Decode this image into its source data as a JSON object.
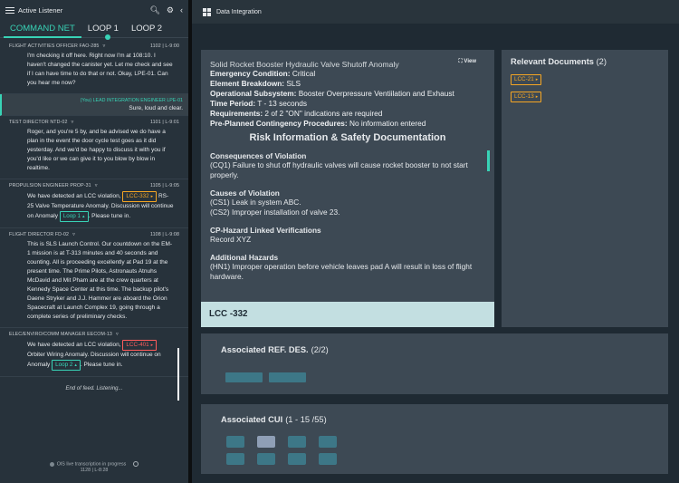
{
  "left_panel": {
    "title": "Active Listener",
    "tabs": [
      {
        "label": "COMMAND NET",
        "active": true
      },
      {
        "label": "LOOP 1",
        "active": false
      },
      {
        "label": "LOOP 2",
        "active": false
      }
    ],
    "messages": [
      {
        "speaker": "FLIGHT ACTIVITIES OFFICER FAO-285",
        "time": "1102 | L-9:00",
        "text": "I'm checking it off here. Right now I'm at 108:10. I haven't changed the canister yet. Let me check and see if I can have time to do that or not. Okay, LPE-01. Can you hear me now?"
      },
      {
        "speaker": "TEST DIRECTOR NTD-02",
        "time": "1101 | L-9:01",
        "text": "Roger, and you're 5 by, and be advised we do have a plan in the event the door cycle test goes as it did yesterday. And we'd be happy to discuss it with you if you'd like or we can give it to you blow by blow in realtime."
      },
      {
        "speaker": "PROPULSION ENGINEER PROP-31",
        "time": "1105 | L-9:05",
        "text_a": "We have detected an LCC violation,",
        "chip": "LCC-332",
        "text_b": "RS-25 Valve Temperature Anomaly. Discussion will continue on Anomaly",
        "loop_chip": "Loop 1",
        "text_c": ". Please tune in."
      },
      {
        "speaker": "FLIGHT DIRECTOR FD-02",
        "time": "1108 | L-9:08",
        "text": "This is SLS Launch Control. Our countdown on the EM-1 mission is at T-313 minutes and 40 seconds and counting. All is proceeding excellently at Pad 19 at the present time. The Prime Pilots, Astronauts Atnuhs McDavid and Mit Pham are at the crew quarters at Kennedy Space Center at this time. The backup pilot's Daene Stryker and J.J. Hammer are aboard the Orion Spacecraft at Launch Complex 19, going through a complete series of preliminary checks."
      },
      {
        "speaker": "ELEC/ENVIRO/COMM MANAGER EECOM-13",
        "time": "",
        "text_a": "We have detected an LCC violation,",
        "chip": "LCC-401",
        "text_b": "Orbiter Wiring Anomaly. Discussion will continue on Anomaly",
        "loop_chip": "Loop 2",
        "text_c": ". Please tune in."
      }
    ],
    "lead_reply": {
      "label": "(You) LEAD INTEGRATION ENGINEER  LPE-01",
      "text": "Sure, loud and clear."
    },
    "end_text": "End of feed. Listening...",
    "footer_status": "OIS live transcription in progress",
    "footer_time": "1128 | L-8:28"
  },
  "topbar": {
    "title": "Data Integration"
  },
  "anomaly": {
    "view_label": "View",
    "title": "Solid Rocket Booster Hydraulic Valve Shutoff Anomaly",
    "fields": [
      {
        "k": "Emergency Condition:",
        "v": "Critical"
      },
      {
        "k": "Element Breakdown:",
        "v": "SLS"
      },
      {
        "k": "Operational Subsystem:",
        "v": "Booster Overpressure Ventiilation and Exhaust"
      },
      {
        "k": "Time Period:",
        "v": "T - 13 seconds"
      },
      {
        "k": "Requirements:",
        "v": "2 of 2 \"ON\" indications are required"
      },
      {
        "k": "Pre-Planned Contingency Procedures:",
        "v": "No information entered"
      }
    ],
    "risk_heading": "Risk Information & Safety Documentation",
    "sections": [
      {
        "title": "Consequences of Violation",
        "lines": [
          "(CQ1) Failure to shut off hydraulic valves will cause rocket booster to not start properly."
        ]
      },
      {
        "title": "Causes of Violation",
        "lines": [
          "(CS1) Leak in system ABC.",
          "(CS2) Improper installation of valve 23."
        ]
      },
      {
        "title": "CP-Hazard Linked Verifications",
        "lines": [
          "Record XYZ"
        ]
      },
      {
        "title": "Additional Hazards",
        "lines": [
          "(HN1) Improper operation before vehicle leaves pad A will result in loss of flight hardware."
        ]
      }
    ],
    "lcc_label": "LCC -332"
  },
  "docs": {
    "title": "Relevant Documents",
    "count": "(2)",
    "items": [
      "LCC-21",
      "LCC-13"
    ]
  },
  "ref_des": {
    "title": "Associated REF. DES.",
    "count": "(2/2)"
  },
  "cui": {
    "title": "Associated CUI",
    "count": "(1 - 15 /55)"
  },
  "colors": {
    "accent": "#38d3b6",
    "warning": "#f6a623",
    "alert": "#ff5c5c",
    "lcc_bar": "#c3dfe1"
  }
}
